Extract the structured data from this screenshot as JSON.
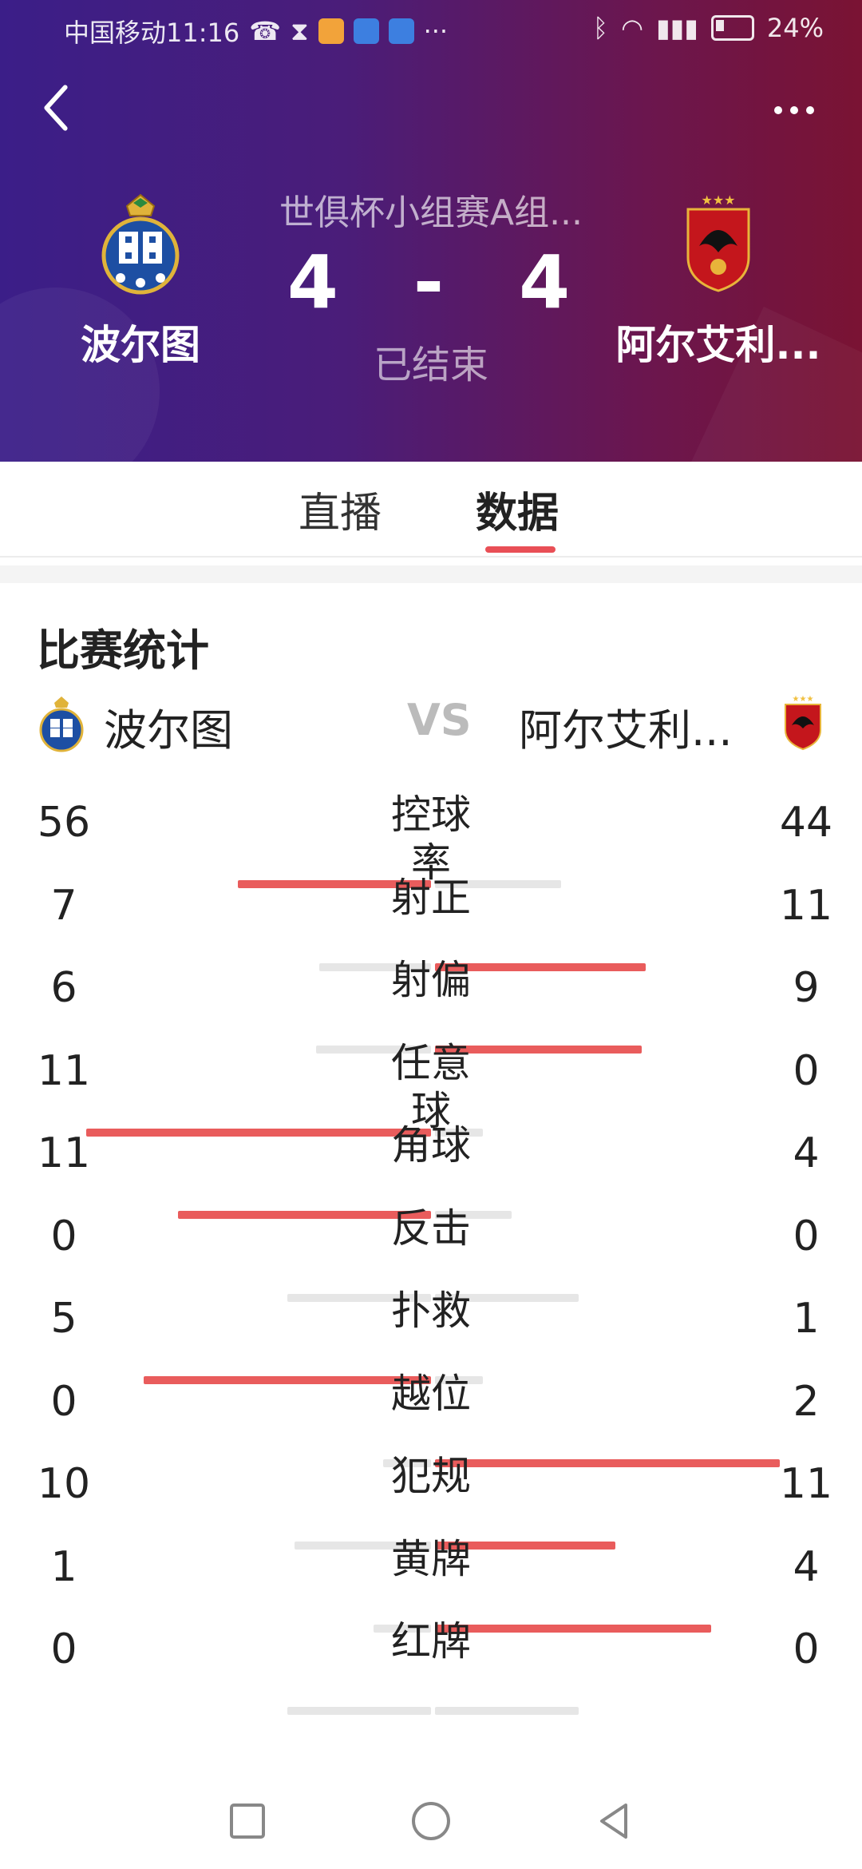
{
  "status_bar": {
    "carrier_time": "中国移动11:16",
    "battery": "24%"
  },
  "match": {
    "competition": "世俱杯小组赛A组...",
    "score_home": "4",
    "score_sep": "-",
    "score_away": "4",
    "state": "已结束",
    "home_team": "波尔图",
    "away_team": "阿尔艾利..."
  },
  "tabs": {
    "live": "直播",
    "stats": "数据"
  },
  "stats_section": {
    "title": "比赛统计",
    "vs": "VS",
    "home_team": "波尔图",
    "away_team": "阿尔艾利..."
  },
  "stats": [
    {
      "label": "控球率",
      "home": 56,
      "away": 44
    },
    {
      "label": "射正",
      "home": 7,
      "away": 11
    },
    {
      "label": "射偏",
      "home": 6,
      "away": 9
    },
    {
      "label": "任意球",
      "home": 11,
      "away": 0
    },
    {
      "label": "角球",
      "home": 11,
      "away": 4
    },
    {
      "label": "反击",
      "home": 0,
      "away": 0
    },
    {
      "label": "扑救",
      "home": 5,
      "away": 1
    },
    {
      "label": "越位",
      "home": 0,
      "away": 2
    },
    {
      "label": "犯规",
      "home": 10,
      "away": 11
    },
    {
      "label": "黄牌",
      "home": 1,
      "away": 4
    },
    {
      "label": "红牌",
      "home": 0,
      "away": 0
    }
  ],
  "colors": {
    "header_start": "#3b1e88",
    "header_end": "#7a1333",
    "accent": "#e94f56",
    "bar_win": "#e95c5c",
    "bar_lose": "#e6e6e6"
  }
}
